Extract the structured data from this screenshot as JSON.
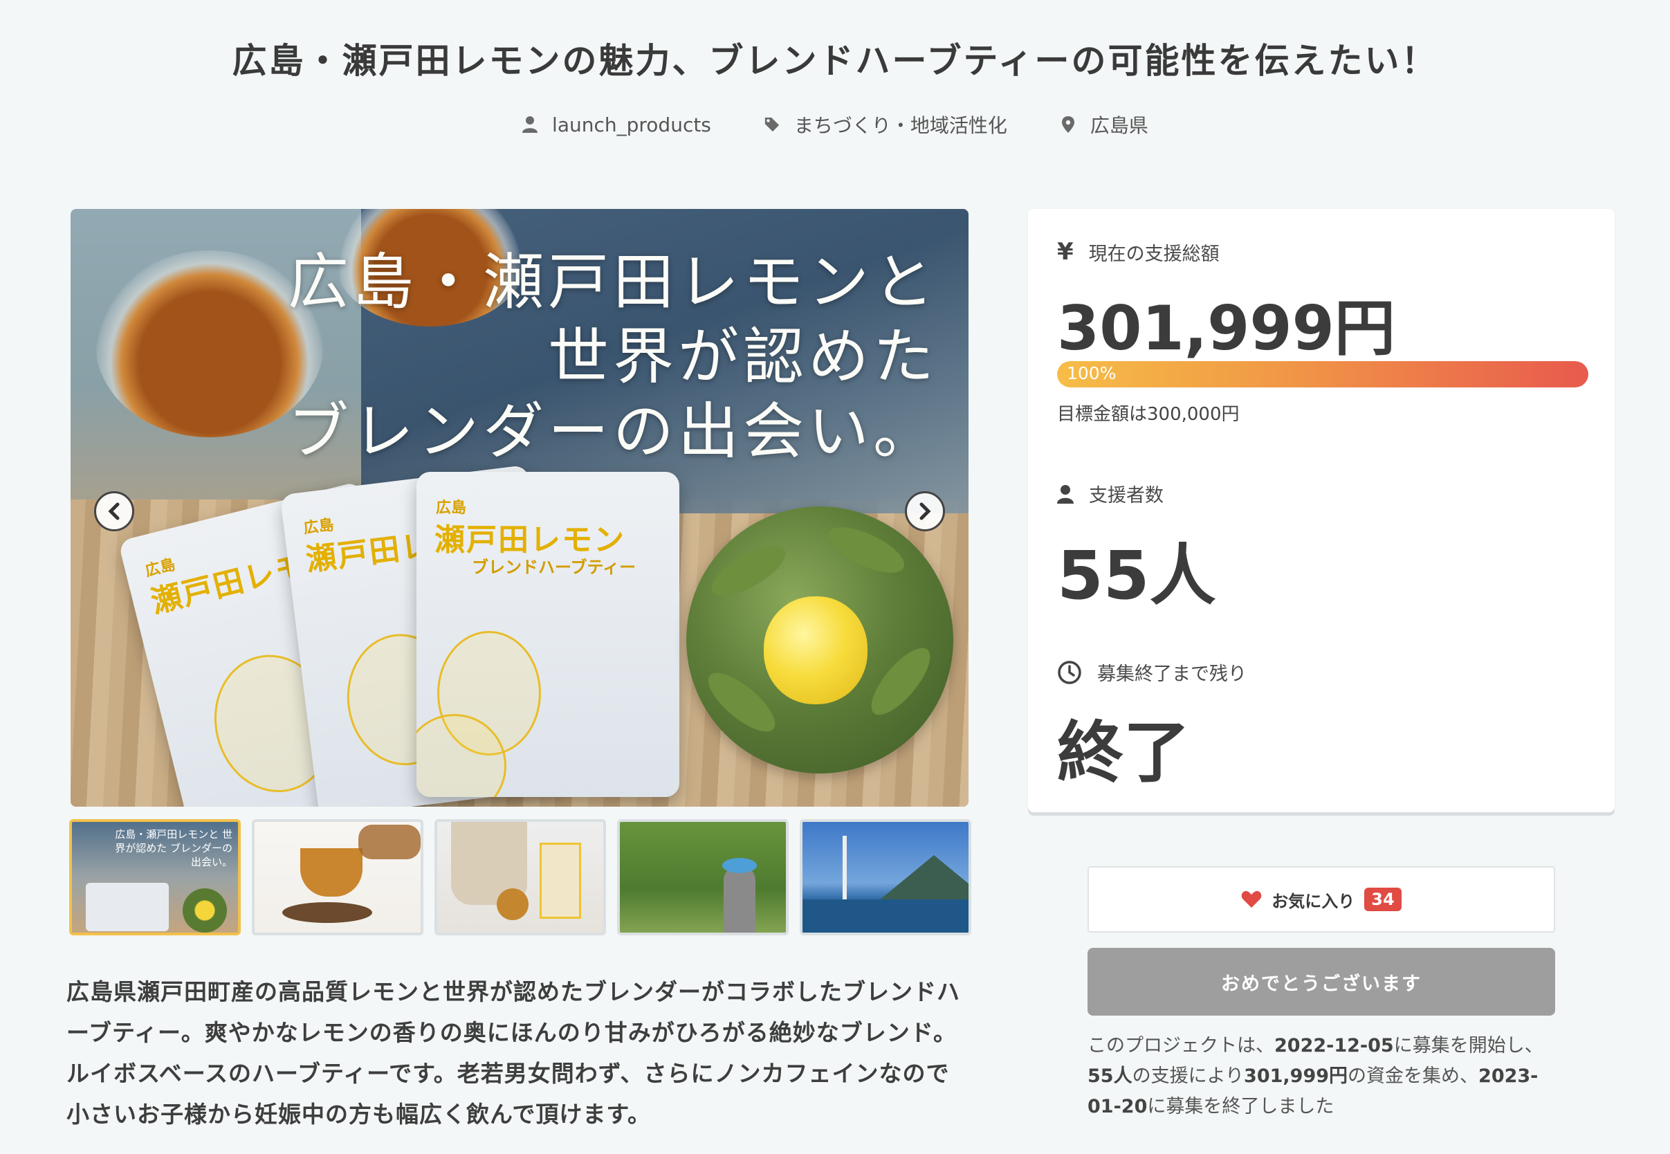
{
  "title": "広島・瀬戸田レモンの魅力、ブレンドハーブティーの可能性を伝えたい！",
  "meta": {
    "owner": "launch_products",
    "category": "まちづくり・地域活性化",
    "location": "広島県"
  },
  "hero": {
    "copy_line1": "広島・瀬戸田レモンと",
    "copy_line2": "世界が認めた",
    "copy_line3": "ブレンダーの出会い。",
    "pouch_small": "広島",
    "pouch_big": "瀬戸田レモン",
    "pouch_sub": "ブレンドハーブティー"
  },
  "stats": {
    "total_label": "現在の支援総額",
    "total_value": "301,999円",
    "progress_label": "100%",
    "progress_fraction": 1.0,
    "goal_text": "目標金額は300,000円",
    "backers_label": "支援者数",
    "backers_value": "55人",
    "remaining_label": "募集終了まで残り",
    "remaining_value": "終了"
  },
  "favorite": {
    "label": "お気に入り",
    "count": "34"
  },
  "done_button": "おめでとうございます",
  "summary": {
    "t1": "このプロジェクトは、",
    "start": "2022-12-05",
    "t2": "に募集を開始し、",
    "backers": "55人",
    "t3": "の支援により",
    "amount": "301,999円",
    "t4": "の資金を集め、",
    "end": "2023-01-20",
    "t5": "に募集を終了しました"
  },
  "description": "広島県瀬戸田町産の高品質レモンと世界が認めたブレンダーがコラボしたブレンドハーブティー。爽やかなレモンの香りの奥にほんのり甘みがひろがる絶妙なブレンド。ルイボスベースのハーブティーです。老若男女問わず、さらにノンカフェインなので小さいお子様から妊娠中の方も幅広く飲んで頂けます。",
  "thumbnails": [
    {
      "caption": "広島・瀬戸田レモンと 世界が認めた ブレンダーの出会い。"
    },
    {
      "caption": ""
    },
    {
      "caption": ""
    },
    {
      "caption": ""
    },
    {
      "caption": ""
    }
  ],
  "colors": {
    "accent_gradient_start": "#f6bd47",
    "accent_gradient_end": "#e85a4d",
    "badge": "#e04b43",
    "heart": "#e04b43",
    "done_button": "#9e9e9e"
  }
}
